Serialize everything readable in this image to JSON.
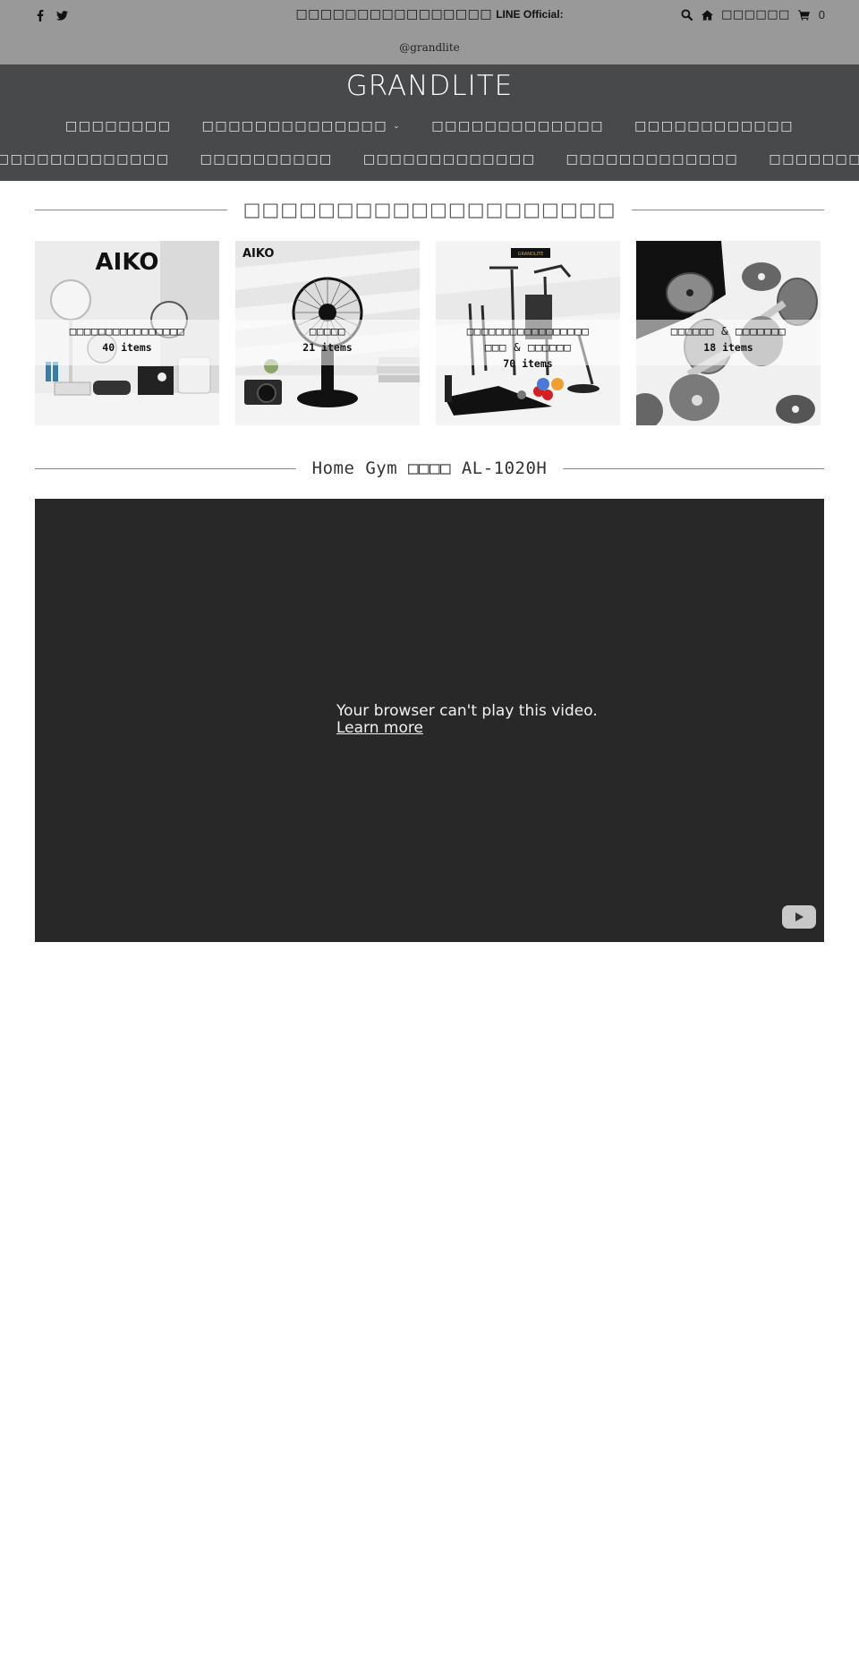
{
  "topbar": {
    "social_icons": [
      "facebook-icon",
      "twitter-icon"
    ],
    "announcement_thai": "□□□□□□□□□□□□□□□□",
    "announcement_bold": "LINE Official:",
    "handle": "@grandlite",
    "tools": {
      "search_icon": "search-icon",
      "home_icon": "home-icon",
      "account_label": "□□□□□□",
      "cart_icon": "cart-icon",
      "cart_count": "0"
    }
  },
  "header": {
    "logo": "GRANDLITE",
    "nav_row1": [
      {
        "label": "□□□□□□□□",
        "has_dropdown": false
      },
      {
        "label": "□□□□□□□□□□□□□□",
        "has_dropdown": true
      },
      {
        "label": "□□□□□□□□□□□□□",
        "has_dropdown": false
      },
      {
        "label": "□□□□□□□□□□□□",
        "has_dropdown": false
      }
    ],
    "nav_row2": [
      {
        "label": "□□□□□□□□□□□□□□□□"
      },
      {
        "label": "□□□□□□□□□□"
      },
      {
        "label": "□□□□□□□□□□□□□"
      },
      {
        "label": "□□□□□□□□□□□□□"
      },
      {
        "label": "□□□□□□□□□□"
      }
    ],
    "dropdown_glyph": "⌄"
  },
  "categories_section": {
    "title": "□□□□□□□□□□□□□□□□□□□□",
    "tiles": [
      {
        "name": "□□□□□□□□□□□□□□□□",
        "count": "40 items",
        "image": "aiko-fans-appliances"
      },
      {
        "name": "□□□□□",
        "count": "21 items",
        "image": "aiko-desk-fan"
      },
      {
        "name_line1": "□□□□□□□□□□□□□□□□□",
        "name_line2": "□□□ & □□□□□□",
        "count": "70 items",
        "image": "home-gym-equipment"
      },
      {
        "name": "□□□□□□ & □□□□□□□",
        "count": "18 items",
        "image": "dumbbells"
      }
    ]
  },
  "video_section": {
    "title": "Home Gym □□□□ AL-1020H",
    "message": "Your browser can't play this video.",
    "link": "Learn more",
    "play_icon": "youtube-icon"
  }
}
